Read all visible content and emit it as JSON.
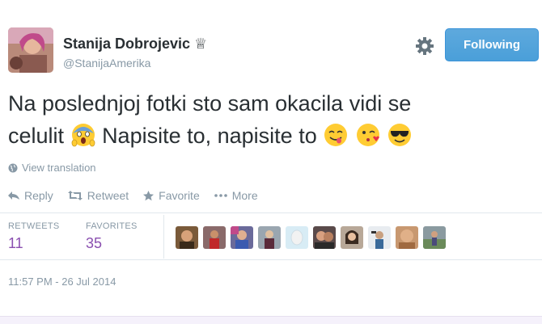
{
  "user": {
    "name": "Stanija Dobrojevic",
    "handle": "@StanijaAmerika"
  },
  "follow_button": {
    "label": "Following"
  },
  "tweet": {
    "text_line1": "Na poslednjoj fotki sto sam okacila vidi se",
    "text_line2_a": "celulit",
    "text_line2_b": "Napisite to, napisite to"
  },
  "view_translation": "View translation",
  "actions": {
    "reply": "Reply",
    "retweet": "Retweet",
    "favorite": "Favorite",
    "more": "More"
  },
  "stats": {
    "retweets_label": "RETWEETS",
    "retweets_count": "11",
    "favorites_label": "FAVORITES",
    "favorites_count": "35"
  },
  "timestamp": "11:57 PM - 26 Jul 2014",
  "colors": {
    "accent": "#55acee",
    "count": "#8a4fb0",
    "muted": "#8899a6"
  }
}
